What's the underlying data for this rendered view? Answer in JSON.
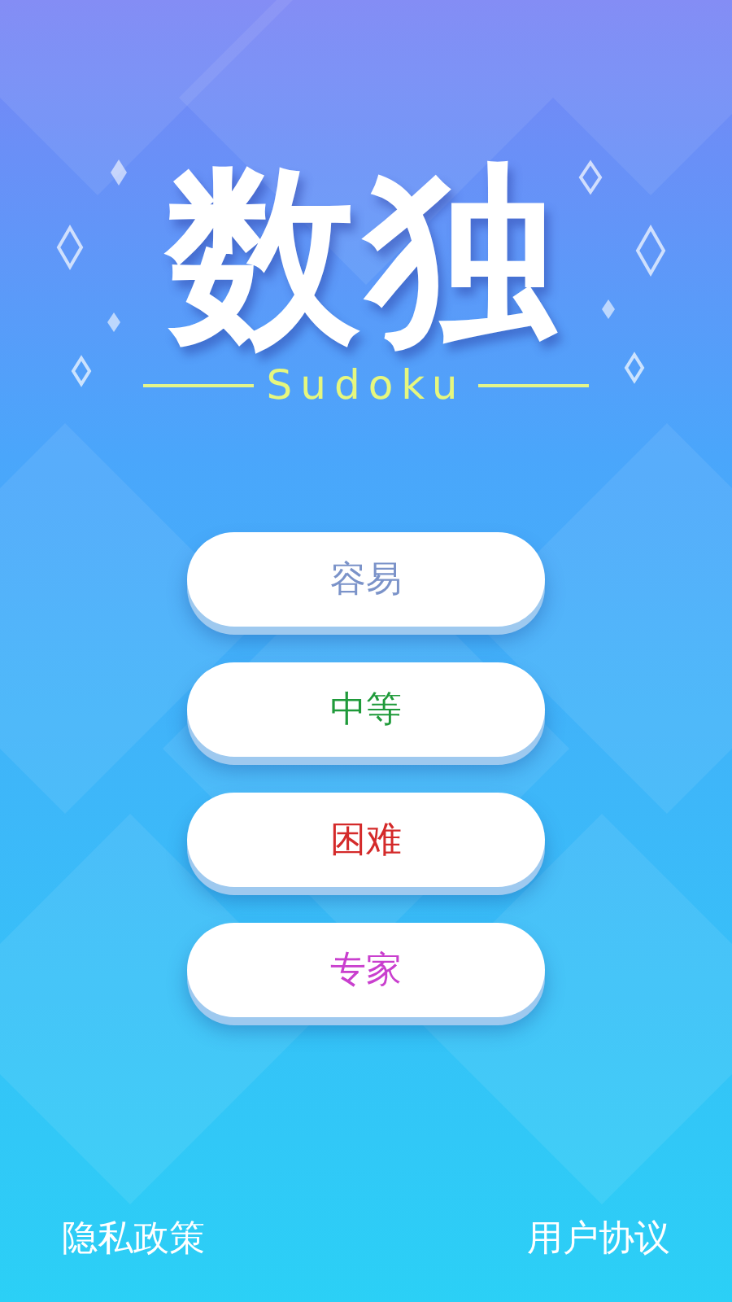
{
  "title": "数独",
  "subtitle": "Sudoku",
  "levels": [
    {
      "label": "容易",
      "color": "#7b93c9"
    },
    {
      "label": "中等",
      "color": "#1f9a3a"
    },
    {
      "label": "困难",
      "color": "#d42a2a"
    },
    {
      "label": "专家",
      "color": "#c93fce"
    }
  ],
  "footer": {
    "left": "隐私政策",
    "right": "用户协议"
  }
}
